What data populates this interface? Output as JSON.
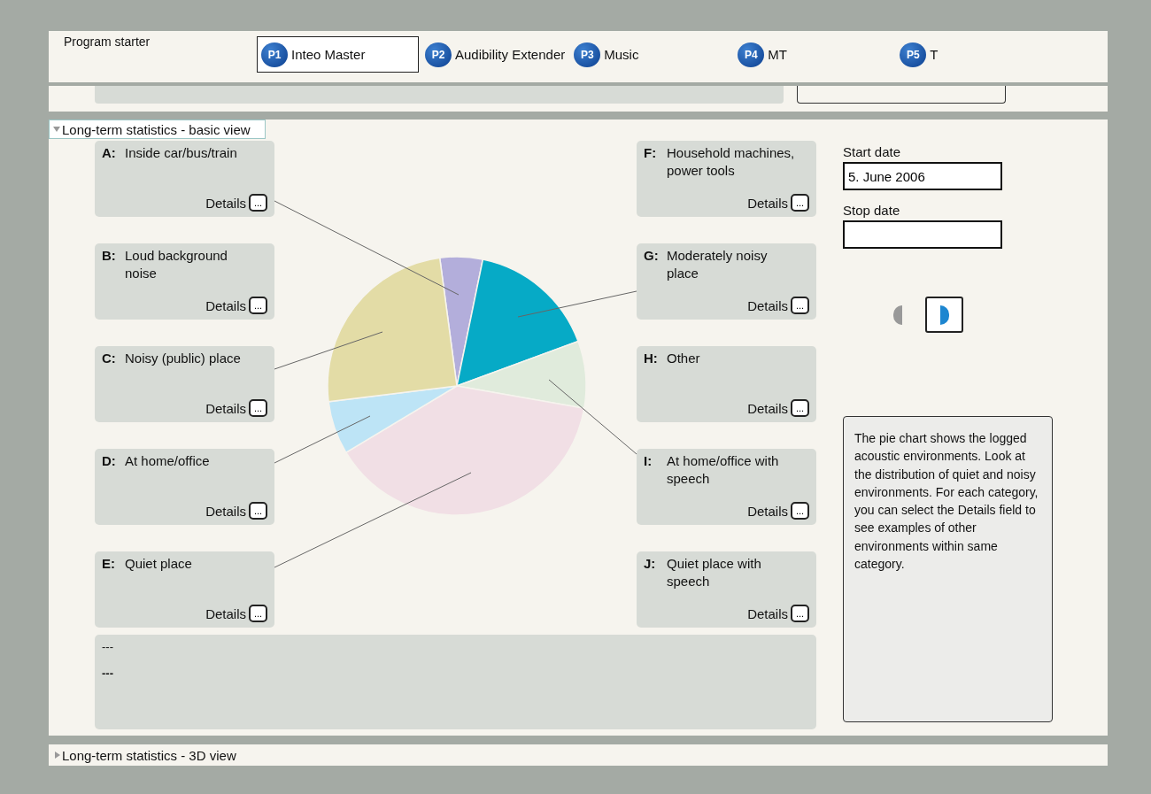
{
  "program_starter": {
    "title": "Program starter",
    "programs": [
      {
        "badge": "P1",
        "label": "Inteo Master",
        "selected": true
      },
      {
        "badge": "P2",
        "label": "Audibility Extender",
        "selected": false
      },
      {
        "badge": "P3",
        "label": "Music",
        "selected": false
      },
      {
        "badge": "P4",
        "label": "MT",
        "selected": false
      },
      {
        "badge": "P5",
        "label": "T",
        "selected": false
      }
    ]
  },
  "basic_view": {
    "title": "Long-term statistics - basic view",
    "expanded": true,
    "categories": [
      {
        "letter": "A:",
        "label": "Inside car/bus/train",
        "details": "Details",
        "button": "..."
      },
      {
        "letter": "B:",
        "label": "Loud background noise",
        "details": "Details",
        "button": "..."
      },
      {
        "letter": "C:",
        "label": "Noisy (public) place",
        "details": "Details",
        "button": "..."
      },
      {
        "letter": "D:",
        "label": "At home/office",
        "details": "Details",
        "button": "..."
      },
      {
        "letter": "E:",
        "label": "Quiet place",
        "details": "Details",
        "button": "..."
      },
      {
        "letter": "F:",
        "label": "Household machines, power tools",
        "details": "Details",
        "button": "..."
      },
      {
        "letter": "G:",
        "label": "Moderately noisy place",
        "details": "Details",
        "button": "..."
      },
      {
        "letter": "H:",
        "label": "Other",
        "details": "Details",
        "button": "..."
      },
      {
        "letter": "I:",
        "label": "At home/office with speech",
        "details": "Details",
        "button": "..."
      },
      {
        "letter": "J:",
        "label": "Quiet place with speech",
        "details": "Details",
        "button": "..."
      }
    ],
    "info_lines": [
      {
        "text": "---",
        "bold": false
      },
      {
        "text": "---",
        "bold": true
      }
    ],
    "start_date": {
      "label": "Start date",
      "value": "5. June 2006"
    },
    "stop_date": {
      "label": "Stop date"
    },
    "view_toggles": [
      {
        "kind": "left",
        "selected": false
      },
      {
        "kind": "right",
        "selected": true
      }
    ],
    "help_text": "The pie chart shows the logged acoustic environments. Look at the distribution of quiet and noisy environments. For each category, you can select the Details field to see examples of other environments within same category."
  },
  "view_3d": {
    "title": "Long-term statistics - 3D view",
    "expanded": false
  }
}
